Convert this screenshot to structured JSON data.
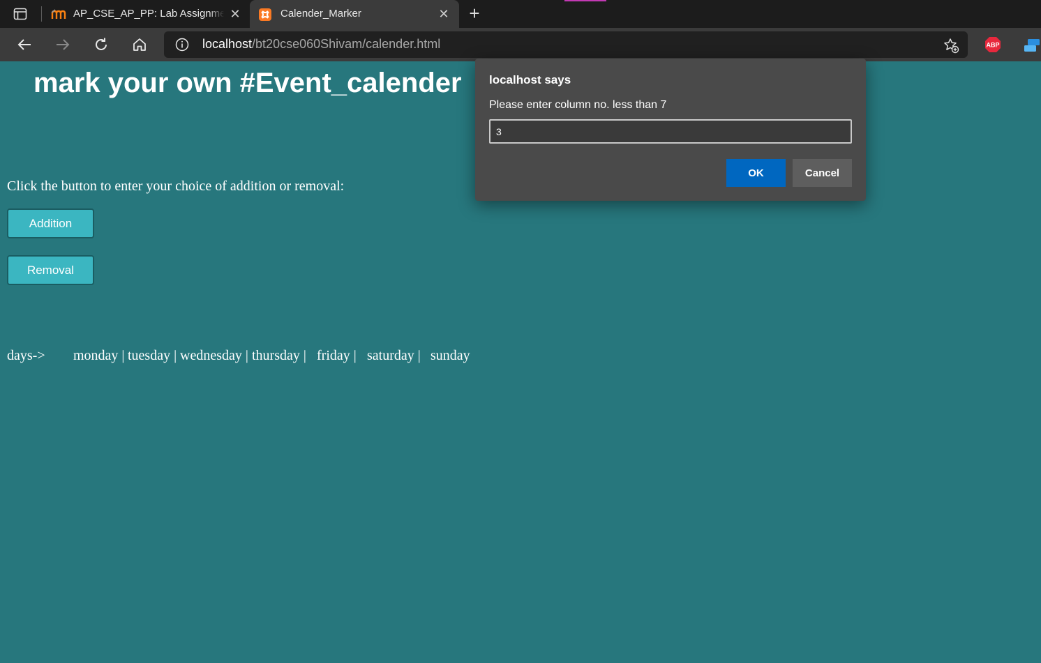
{
  "browser": {
    "tabs": [
      {
        "title": "AP_CSE_AP_PP: Lab Assignment (",
        "favicon": "moodle-m-icon",
        "active": false
      },
      {
        "title": "Calender_Marker",
        "favicon": "xampp-icon",
        "active": true
      }
    ],
    "address": {
      "host": "localhost",
      "path": "/bt20cse060Shivam/calender.html"
    }
  },
  "page": {
    "heading": "mark your own #Event_calender",
    "instruction": "Click the button to enter your choice of addition or removal:",
    "buttons": {
      "addition": "Addition",
      "removal": "Removal"
    },
    "days_label": "days->",
    "days": [
      "monday |",
      "tuesday |",
      "wednesday |",
      "thursday |",
      "friday |",
      "saturday |",
      "sunday"
    ]
  },
  "dialog": {
    "title": "localhost says",
    "message": "Please enter column no. less than 7",
    "input_value": "3",
    "ok_label": "OK",
    "cancel_label": "Cancel"
  },
  "colors": {
    "page_background": "#27777d",
    "button_fill": "#3bb6c1",
    "dialog_background": "#4a4a4a",
    "ok_button": "#0067c0"
  }
}
